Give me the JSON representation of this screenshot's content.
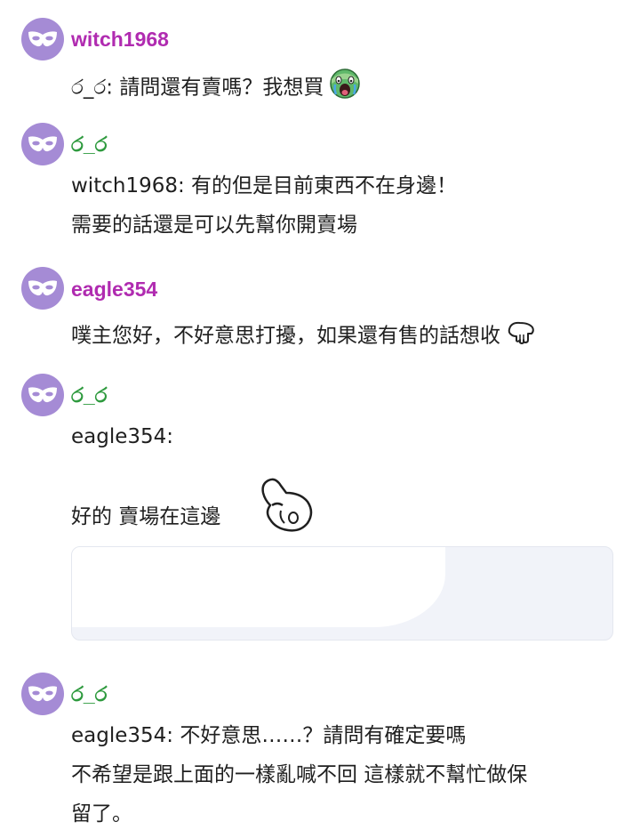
{
  "posts": [
    {
      "username": "witch1968",
      "lines": [
        "ර_ර: 請問還有賣嗎？我想買"
      ],
      "emoji": "crying-face"
    },
    {
      "username": "ර_ර",
      "lines": [
        "witch1968: 有的但是目前東西不在身邊！",
        "需要的話還是可以先幫你開賣場"
      ]
    },
    {
      "username": "eagle354",
      "lines": [
        "噗主您好，不好意思打擾，如果還有售的話想收"
      ],
      "emoji": "bowing-hand"
    },
    {
      "username": "ර_ර",
      "lines": [
        "eagle354:",
        "好的 賣場在這邊"
      ],
      "emoji": "pointing-hand"
    },
    {
      "username": "ර_ර",
      "lines": [
        "eagle354: 不好意思……？請問有確定要嗎",
        "不希望是跟上面的一樣亂喊不回 這樣就不幫忙做保",
        "留了。"
      ]
    }
  ],
  "avatar_icon": "mask-icon",
  "colors": {
    "avatar_bg": "#a58bd5",
    "username_purple": "#b02bb0",
    "username_green": "#2e9a3e",
    "text": "#1f1f1f",
    "link_card_bg": "#f1f3f9"
  }
}
